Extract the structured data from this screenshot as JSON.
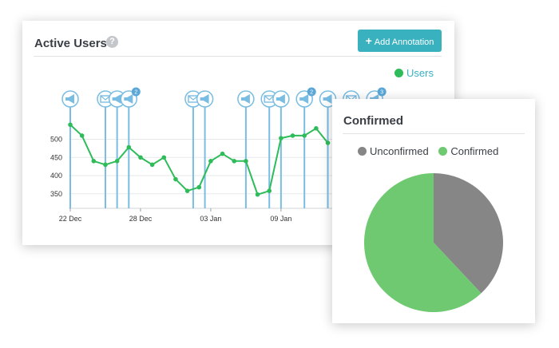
{
  "active_users": {
    "title": "Active Users",
    "help_icon": "?",
    "add_annotation_label": "Add Annotation",
    "legend_label": "Users",
    "line_color": "#2ebc5a",
    "annotation_color": "#79bde3",
    "annotations": [
      {
        "x": 0,
        "icon": "megaphone-icon"
      },
      {
        "x": 3,
        "icon": "envelope-icon"
      },
      {
        "x": 4,
        "icon": "megaphone-icon"
      },
      {
        "x": 5,
        "icon": "megaphone-icon",
        "badge": "2"
      },
      {
        "x": 10.5,
        "icon": "envelope-icon"
      },
      {
        "x": 11.5,
        "icon": "megaphone-icon"
      },
      {
        "x": 15,
        "icon": "megaphone-icon"
      },
      {
        "x": 17,
        "icon": "envelope-icon"
      },
      {
        "x": 18,
        "icon": "megaphone-icon"
      },
      {
        "x": 20,
        "icon": "megaphone-icon",
        "badge": "2"
      },
      {
        "x": 22,
        "icon": "megaphone-icon"
      },
      {
        "x": 24,
        "icon": "envelope-icon"
      },
      {
        "x": 26,
        "icon": "megaphone-icon",
        "badge": "3"
      }
    ]
  },
  "confirmed": {
    "title": "Confirmed",
    "colors": {
      "unconfirmed": "#868686",
      "confirmed": "#6ec971"
    }
  },
  "chart_data": [
    {
      "type": "line",
      "title": "Active Users",
      "x_tick_labels": [
        {
          "x": 0,
          "label": "22 Dec"
        },
        {
          "x": 6,
          "label": "28 Dec"
        },
        {
          "x": 12,
          "label": "03 Jan"
        },
        {
          "x": 18,
          "label": "09 Jan"
        }
      ],
      "yticks": [
        350,
        400,
        450,
        500
      ],
      "ylim": [
        310,
        545
      ],
      "grid": true,
      "legend": "top-right",
      "series": [
        {
          "name": "Users",
          "points": [
            {
              "x": 0,
              "y": 540
            },
            {
              "x": 1,
              "y": 510
            },
            {
              "x": 2,
              "y": 440
            },
            {
              "x": 3,
              "y": 430
            },
            {
              "x": 4,
              "y": 440
            },
            {
              "x": 5,
              "y": 478
            },
            {
              "x": 6,
              "y": 450
            },
            {
              "x": 7,
              "y": 430
            },
            {
              "x": 8,
              "y": 450
            },
            {
              "x": 9,
              "y": 390
            },
            {
              "x": 10,
              "y": 358
            },
            {
              "x": 11,
              "y": 368
            },
            {
              "x": 12,
              "y": 440
            },
            {
              "x": 13,
              "y": 460
            },
            {
              "x": 14,
              "y": 440
            },
            {
              "x": 15,
              "y": 440
            },
            {
              "x": 16,
              "y": 348
            },
            {
              "x": 17,
              "y": 358
            },
            {
              "x": 18,
              "y": 503
            },
            {
              "x": 19,
              "y": 510
            },
            {
              "x": 20,
              "y": 510
            },
            {
              "x": 21,
              "y": 530
            },
            {
              "x": 22,
              "y": 490
            }
          ]
        }
      ]
    },
    {
      "type": "pie",
      "title": "Confirmed",
      "legend": "top",
      "slices": [
        {
          "label": "Unconfirmed",
          "value": 38
        },
        {
          "label": "Confirmed",
          "value": 62
        }
      ]
    }
  ]
}
